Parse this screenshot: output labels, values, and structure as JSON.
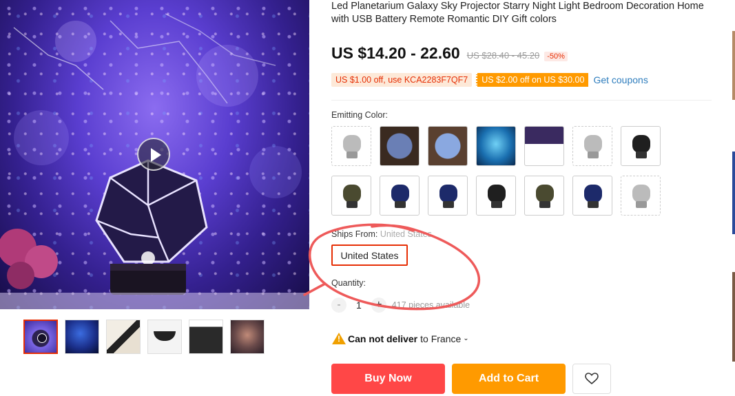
{
  "product": {
    "title": "Led Planetarium Galaxy Sky Projector Starry Night Light Bedroom Decoration Home with USB Battery Remote Romantic DIY Gift colors",
    "price": "US $14.20 - 22.60",
    "original_price": "US $28.40 - 45.20",
    "discount": "-50%"
  },
  "coupons": {
    "store_coupon": "US $1.00 off, use KCA2283F7QF7",
    "select_coupon": "US $2.00 off on US $30.00",
    "get_coupons": "Get coupons"
  },
  "options": {
    "color_label": "Emitting Color:",
    "ships_from_label": "Ships From:",
    "ships_from_value": "United States",
    "ships_from_selected": "United States"
  },
  "quantity": {
    "label": "Quantity:",
    "minus": "-",
    "value": "1",
    "plus": "+",
    "available": "417 pieces available"
  },
  "delivery": {
    "warning": "Can not deliver",
    "to": "to France"
  },
  "actions": {
    "buy_now": "Buy Now",
    "add_to_cart": "Add to Cart"
  },
  "colors": {
    "accent_red": "#e62e04",
    "buy_now_bg": "#ff4747",
    "add_to_cart_bg": "#ff9a00",
    "link_blue": "#2e7dbd",
    "annotation_stroke": "#ee5a5a"
  },
  "icons": {
    "video": "play-icon",
    "wishlist": "heart-icon",
    "warning": "warning-icon",
    "dropdown": "chevron-down-icon"
  }
}
